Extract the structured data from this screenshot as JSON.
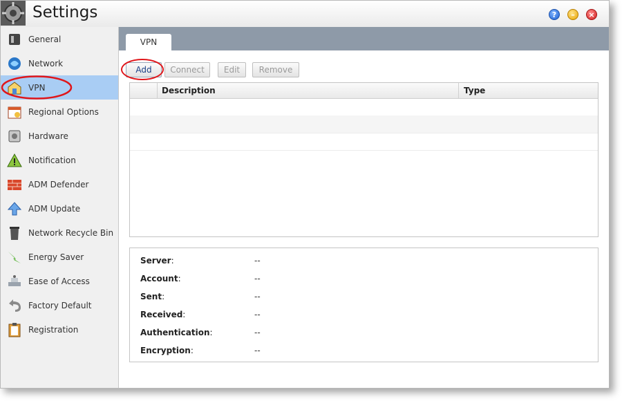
{
  "window": {
    "title": "Settings",
    "controls": {
      "help": "?",
      "minimize": "–",
      "close": "×"
    }
  },
  "sidebar": {
    "items": [
      {
        "label": "General",
        "icon": "general-icon",
        "selected": false
      },
      {
        "label": "Network",
        "icon": "network-icon",
        "selected": false
      },
      {
        "label": "VPN",
        "icon": "vpn-icon",
        "selected": true
      },
      {
        "label": "Regional Options",
        "icon": "calendar-icon",
        "selected": false
      },
      {
        "label": "Hardware",
        "icon": "hardware-icon",
        "selected": false
      },
      {
        "label": "Notification",
        "icon": "warning-icon",
        "selected": false
      },
      {
        "label": "ADM Defender",
        "icon": "firewall-icon",
        "selected": false
      },
      {
        "label": "ADM Update",
        "icon": "update-arrow-icon",
        "selected": false
      },
      {
        "label": "Network Recycle Bin",
        "icon": "recycle-bin-icon",
        "selected": false
      },
      {
        "label": "Energy Saver",
        "icon": "energy-icon",
        "selected": false
      },
      {
        "label": "Ease of Access",
        "icon": "access-icon",
        "selected": false
      },
      {
        "label": "Factory Default",
        "icon": "undo-icon",
        "selected": false
      },
      {
        "label": "Registration",
        "icon": "clipboard-icon",
        "selected": false
      }
    ]
  },
  "tabs": [
    {
      "label": "VPN",
      "active": true
    }
  ],
  "toolbar": {
    "add_label": "Add",
    "connect_label": "Connect",
    "edit_label": "Edit",
    "remove_label": "Remove"
  },
  "grid": {
    "columns": [
      "",
      "Description",
      "Type"
    ],
    "rows": []
  },
  "info": [
    {
      "key": "Server",
      "value": "--"
    },
    {
      "key": "Account",
      "value": "--"
    },
    {
      "key": "Sent",
      "value": "--"
    },
    {
      "key": "Received",
      "value": "--"
    },
    {
      "key": "Authentication",
      "value": "--"
    },
    {
      "key": "Encryption",
      "value": "--"
    }
  ],
  "colors": {
    "selected_bg": "#a9cdf4",
    "tabbar_bg": "#8e9aa8",
    "highlight_ring": "#e0161a"
  }
}
